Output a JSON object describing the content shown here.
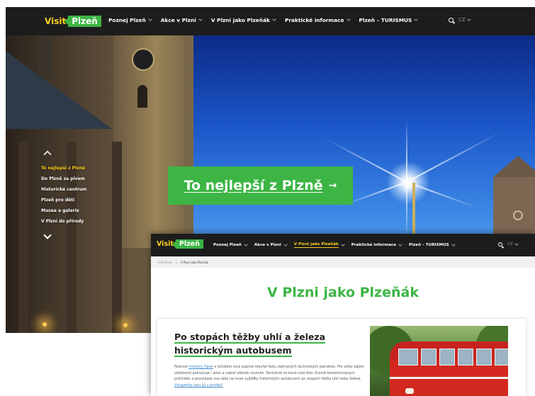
{
  "back_page": {
    "logo": {
      "visit": "Visit",
      "city": "Plzeň"
    },
    "nav": {
      "items": [
        {
          "label": "Poznej Plzeň"
        },
        {
          "label": "Akce v Plzni"
        },
        {
          "label": "V Plzni jako Plzeňák"
        },
        {
          "label": "Praktické informace"
        },
        {
          "label": "Plzeň – TURISMUS"
        }
      ],
      "lang": "CZ"
    },
    "hero": {
      "side_nav": [
        "To nejlepší z Plzně",
        "Do Plzně za pivem",
        "Historické centrum",
        "Plzeň pro děti",
        "Muzea a galerie",
        "V Plzni do přírody"
      ],
      "active_index": 0,
      "cta_label": "To nejlepší z Plzně",
      "cta_arrow": "→"
    }
  },
  "front_page": {
    "logo": {
      "visit": "Visit",
      "city": "Plzeň"
    },
    "nav": {
      "items": [
        {
          "label": "Poznej Plzeň"
        },
        {
          "label": "Akce v Plzni"
        },
        {
          "label": "V Plzni jako Plzeňák"
        },
        {
          "label": "Praktické informace"
        },
        {
          "label": "Plzeň – TURISMUS"
        }
      ],
      "active_index": 2,
      "lang": "CZ"
    },
    "breadcrumb": {
      "home": "Visit Plzeň",
      "separator": ">",
      "current": "V Plzni jako Plzeňák"
    },
    "title": "V Plzni jako Plzeňák",
    "article": {
      "title": "Po stopách těžby uhlí a železa historickým autobusem",
      "text_1": "Festival ",
      "link_1": "Industry Open",
      "text_2": " v loňském roce poprvé otevřel řadu zajímavých technických památek. Pro velký zájem veřejnosti pokračuje i letos a nabízí několik novinek. Tentokrát se koná celé léto. Kromě komentovaných prohlídek a procházek zve také na nové vyjížďky historickým autobusem po stopách těžby uhlí nebo železa. ",
      "link_2": "Vstupenky jsou již v prodeji!"
    },
    "colors": {
      "brand_green": "#3cb544",
      "brand_yellow": "#ffd21f",
      "nav_background": "#1c1c1c"
    }
  }
}
